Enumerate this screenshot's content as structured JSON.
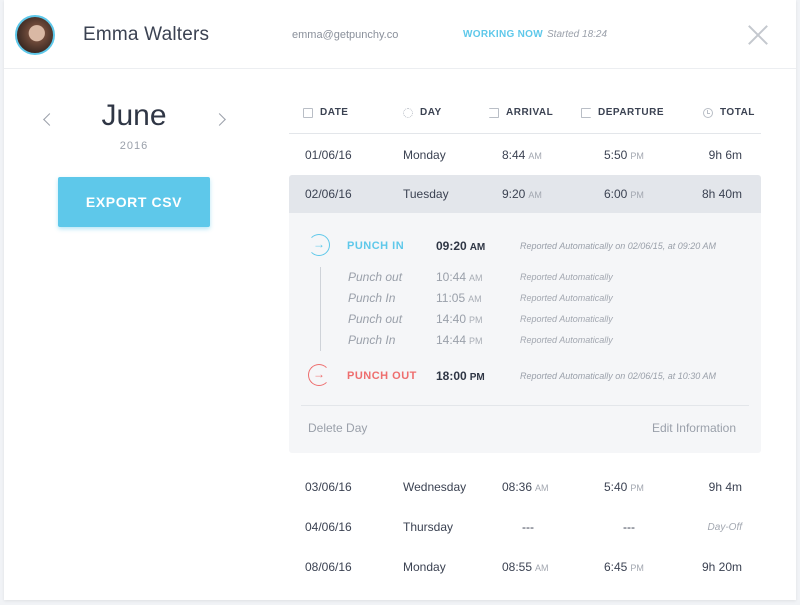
{
  "header": {
    "name": "Emma Walters",
    "email": "emma@getpunchy.co",
    "status": "WORKING NOW",
    "started": "Started 18:24"
  },
  "calendar": {
    "month": "June",
    "year": "2016",
    "export_label": "EXPORT CSV"
  },
  "table": {
    "columns": {
      "date": "DATE",
      "day": "DAY",
      "arrival": "ARRIVAL",
      "departure": "DEPARTURE",
      "total": "TOTAL"
    },
    "rows": [
      {
        "date": "01/06/16",
        "day": "Monday",
        "arrival": "8:44",
        "arrival_suffix": "AM",
        "departure": "5:50",
        "departure_suffix": "PM",
        "total": "9h 6m"
      },
      {
        "date": "02/06/16",
        "day": "Tuesday",
        "arrival": "9:20",
        "arrival_suffix": "AM",
        "departure": "6:00",
        "departure_suffix": "PM",
        "total": "8h 40m"
      },
      {
        "date": "03/06/16",
        "day": "Wednesday",
        "arrival": "08:36",
        "arrival_suffix": "AM",
        "departure": "5:40",
        "departure_suffix": "PM",
        "total": "9h 4m"
      },
      {
        "date": "04/06/16",
        "day": "Thursday",
        "arrival": "---",
        "departure": "---",
        "total": "Day-Off"
      },
      {
        "date": "08/06/16",
        "day": "Monday",
        "arrival": "08:55",
        "arrival_suffix": "AM",
        "departure": "6:45",
        "departure_suffix": "PM",
        "total": "9h 20m"
      }
    ]
  },
  "detail": {
    "punch_in": {
      "label": "PUNCH IN",
      "time": "09:20",
      "suffix": "AM",
      "note": "Reported Automatically on 02/06/15, at 09:20 AM"
    },
    "entries": [
      {
        "label": "Punch out",
        "time": "10:44",
        "suffix": "AM",
        "note": "Reported Automatically"
      },
      {
        "label": "Punch In",
        "time": "11:05",
        "suffix": "AM",
        "note": "Reported Automatically"
      },
      {
        "label": "Punch out",
        "time": "14:40",
        "suffix": "PM",
        "note": "Reported Automatically"
      },
      {
        "label": "Punch In",
        "time": "14:44",
        "suffix": "PM",
        "note": "Reported Automatically"
      }
    ],
    "punch_out": {
      "label": "PUNCH OUT",
      "time": "18:00",
      "suffix": "PM",
      "note": "Reported Automatically on 02/06/15, at 10:30 AM"
    },
    "delete_label": "Delete Day",
    "edit_label": "Edit Information"
  },
  "colors": {
    "accent": "#5ec8ea",
    "punch_out": "#ee6e6e"
  }
}
